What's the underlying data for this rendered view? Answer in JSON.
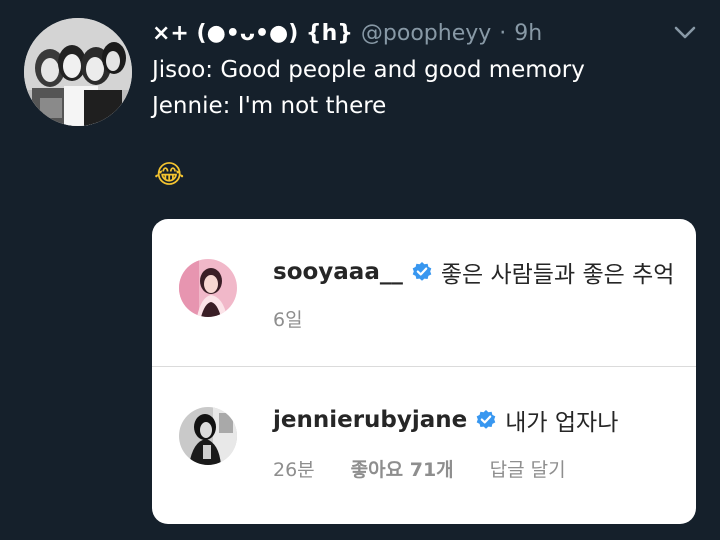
{
  "tweet": {
    "display_name": "×+ (●•ᴗ•●) {h}",
    "handle": "@poopheyy",
    "separator": "·",
    "time": "9h",
    "lines": [
      "Jisoo: Good people and good memory",
      "Jennie: I'm not there"
    ],
    "emoji": "😂"
  },
  "instagram_comments": [
    {
      "username": "sooyaaa__",
      "text": "좋은 사람들과 좋은 추억",
      "time": "6일",
      "avatar_icon": "profile-photo-pink"
    },
    {
      "username": "jennierubyjane",
      "text": "내가 업자나",
      "time": "26분",
      "likes": "좋아요 71개",
      "reply": "답글 달기",
      "avatar_icon": "profile-photo-bw"
    }
  ],
  "colors": {
    "background": "#15202b",
    "secondary_text": "#8899a6",
    "verified_blue": "#3897f0",
    "card_background": "#ffffff"
  }
}
